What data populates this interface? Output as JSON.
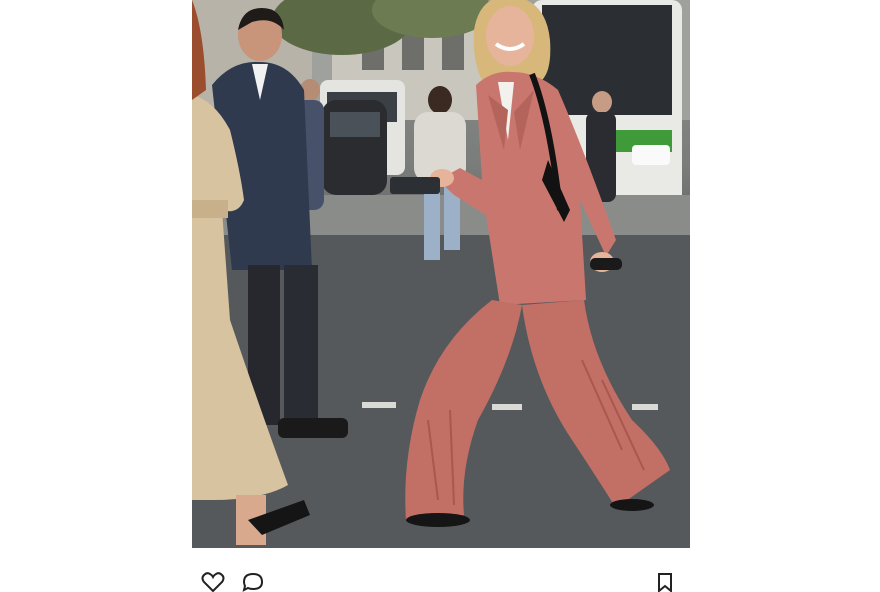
{
  "post": {
    "photo": {
      "subject": "street-style-pink-corduroy-suit"
    },
    "actions": {
      "like_icon": "heart-icon",
      "comment_icon": "comment-icon",
      "save_icon": "bookmark-icon"
    }
  },
  "colors": {
    "page_background": "#ffffff",
    "suit_pink": "#c9776e",
    "asphalt": "#55585b",
    "trench_beige": "#d8c3a1",
    "navy_suit": "#2f3a4e"
  }
}
